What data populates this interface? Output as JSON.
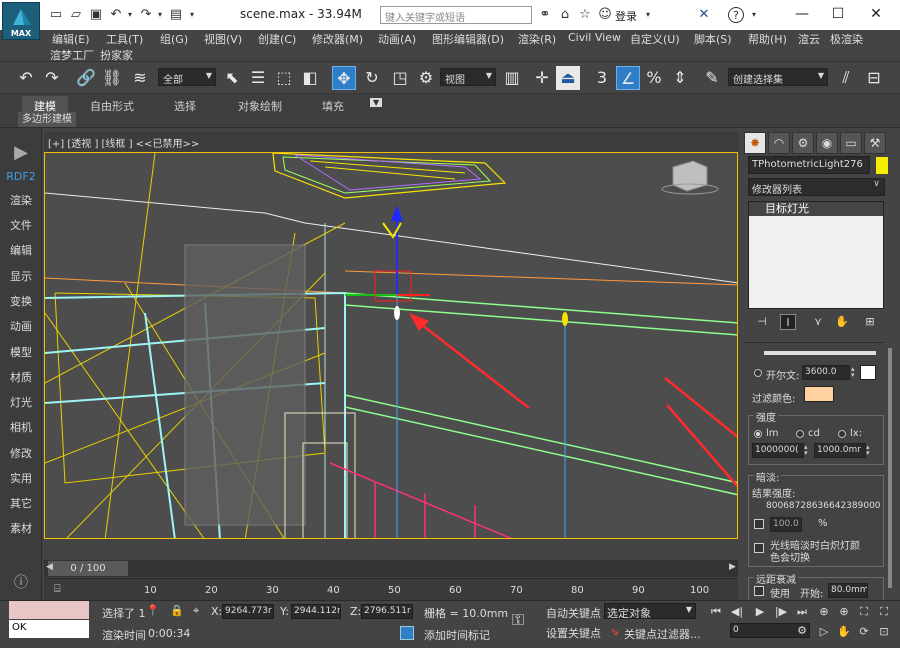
{
  "title_bar": {
    "doc_title": "scene.max - 33.94M",
    "search_placeholder": "键入关键字或短语",
    "login": "登录",
    "logo_text": "MAX"
  },
  "menu": {
    "row1": [
      "编辑(E)",
      "工具(T)",
      "组(G)",
      "视图(V)",
      "创建(C)",
      "修改器(M)",
      "动画(A)",
      "图形编辑器(D)",
      "渲染(R)",
      "Civil View",
      "自定义(U)",
      "脚本(S)",
      "帮助(H)",
      "渲云",
      "极渲染"
    ],
    "row2": [
      "渲梦工厂",
      "扮家家"
    ]
  },
  "toolbar": {
    "filter_value": "全部",
    "ref_coord_value": "视图",
    "selection_set_value": "创建选择集",
    "snap_label": "3"
  },
  "ribbon": {
    "tabs": [
      "建模",
      "自由形式",
      "选择",
      "对象绘制",
      "填充"
    ],
    "sub_label": "多边形建模"
  },
  "left_panel": {
    "items": [
      "RDF2",
      "渲染",
      "文件",
      "编辑",
      "显示",
      "变换",
      "动画",
      "模型",
      "材质",
      "灯光",
      "相机",
      "修改",
      "实用",
      "其它",
      "素材"
    ]
  },
  "viewport": {
    "header": "[+] [透视 ] [线框 ] <<已禁用>>"
  },
  "command_panel": {
    "object_name": "TPhotometricLight276",
    "object_color": "#f5ee00",
    "modifier_list": "修改器列表",
    "stack_item": "目标灯光",
    "kelvin_label": "开尔文:",
    "kelvin_value": "3600.0",
    "filter_color_label": "过滤颜色:",
    "filter_color": "#ffd0a0",
    "intensity_group": "强度",
    "unit_lm": "lm",
    "unit_cd": "cd",
    "unit_lx": "lx:",
    "intensity_value": "1000000(",
    "distance_value": "1000.0mr",
    "dimming_group": "暗淡:",
    "result_intensity_label": "结果强度:",
    "result_intensity_value": "80068728636642389000",
    "percent_value": "100.0",
    "percent_unit": "%",
    "dim_option_line1": "光线暗淡时白炽灯颜",
    "dim_option_line2": "色会切换",
    "far_atten_group": "远距衰减",
    "use_label": "使用",
    "start_label": "开始:",
    "start_value": "80.0mm"
  },
  "timeline": {
    "frame_display": "0 / 100",
    "ticks": [
      "10",
      "20",
      "30",
      "40",
      "50",
      "60",
      "70",
      "80",
      "90",
      "100"
    ]
  },
  "status_bar": {
    "maxscript_text": "OK",
    "selection_status": "选择了 1",
    "render_time_label": "渲染时间",
    "render_time_value": "0:00:34",
    "x_label": "X:",
    "x_value": "9264.773r",
    "y_label": "Y:",
    "y_value": "2944.112r",
    "z_label": "Z:",
    "z_value": "2796.511r",
    "grid": "栅格 = 10.0mm",
    "add_time_tag": "添加时间标记",
    "auto_key": "自动关键点",
    "set_key": "设置关键点",
    "selected_object": "选定对象",
    "key_filters": "关键点过滤器...",
    "current_frame": "0"
  }
}
